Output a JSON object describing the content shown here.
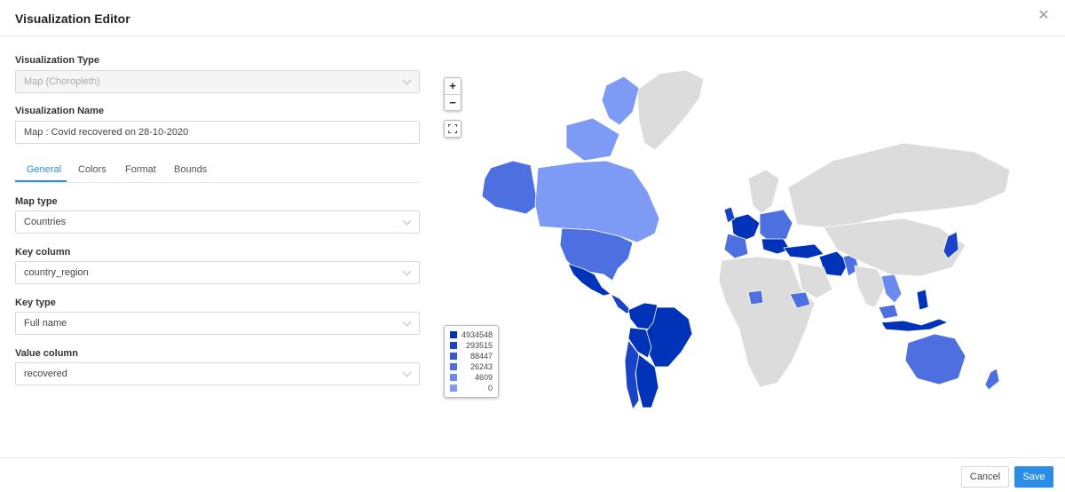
{
  "dialog": {
    "title": "Visualization Editor",
    "close_glyph": "✕"
  },
  "form": {
    "viz_type_label": "Visualization Type",
    "viz_type_value": "Map (Choropleth)",
    "viz_name_label": "Visualization Name",
    "viz_name_value": "Map : Covid recovered on 28-10-2020",
    "tabs": [
      "General",
      "Colors",
      "Format",
      "Bounds"
    ],
    "active_tab": "General",
    "map_type_label": "Map type",
    "map_type_value": "Countries",
    "key_column_label": "Key column",
    "key_column_value": "country_region",
    "key_type_label": "Key type",
    "key_type_value": "Full name",
    "value_column_label": "Value column",
    "value_column_value": "recovered"
  },
  "map": {
    "zoom_in": "+",
    "zoom_out": "−",
    "colors": {
      "land_nodata": "#dcdcdc",
      "border": "#ffffff",
      "c1": "#0033b8",
      "c2": "#1a43c8",
      "c3": "#3358d6",
      "c4": "#4d6fe0",
      "c5": "#6a8af0",
      "c6": "#7d9bf5"
    },
    "legend": [
      {
        "value": "4934548",
        "color": "#0033b8"
      },
      {
        "value": "293515",
        "color": "#1a43c8"
      },
      {
        "value": "88447",
        "color": "#3358d6"
      },
      {
        "value": "26243",
        "color": "#4d6fe0"
      },
      {
        "value": "4609",
        "color": "#6a8af0"
      },
      {
        "value": "0",
        "color": "#7d9bf5"
      }
    ]
  },
  "footer": {
    "cancel_label": "Cancel",
    "save_label": "Save"
  }
}
